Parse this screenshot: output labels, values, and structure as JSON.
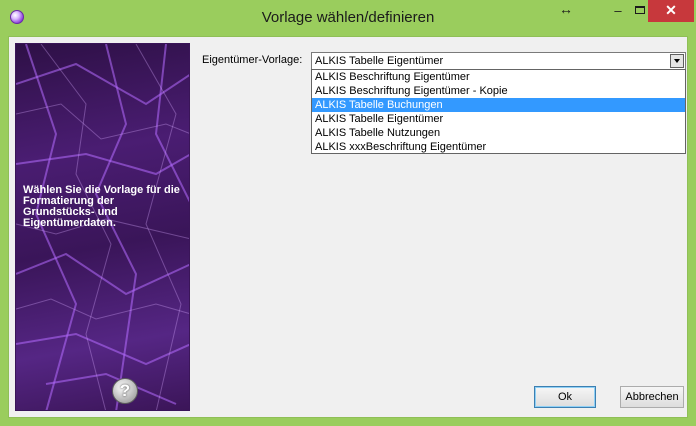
{
  "window": {
    "title": "Vorlage wählen/definieren",
    "titlebar_color": "#9acd5d",
    "controls": {
      "resize_glyph": "↔",
      "minimize_glyph": "–",
      "close_glyph": "✕"
    }
  },
  "side_panel": {
    "description": "Wählen Sie die Vorlage für die Formatierung der Grundstücks- und Eigentümerdaten.",
    "help_glyph": "?"
  },
  "form": {
    "owner_template_label": "Eigentümer-Vorlage:",
    "owner_template_value": "ALKIS Tabelle Eigentümer",
    "options": [
      {
        "label": "ALKIS Beschriftung Eigentümer",
        "selected": false
      },
      {
        "label": "ALKIS Beschriftung Eigentümer - Kopie",
        "selected": false
      },
      {
        "label": "ALKIS Tabelle Buchungen",
        "selected": true
      },
      {
        "label": "ALKIS Tabelle Eigentümer",
        "selected": false
      },
      {
        "label": "ALKIS Tabelle Nutzungen",
        "selected": false
      },
      {
        "label": "ALKIS xxxBeschriftung Eigentümer",
        "selected": false
      }
    ],
    "highlight_color": "#3399ff"
  },
  "buttons": {
    "ok_label": "Ok",
    "cancel_label": "Abbrechen"
  }
}
